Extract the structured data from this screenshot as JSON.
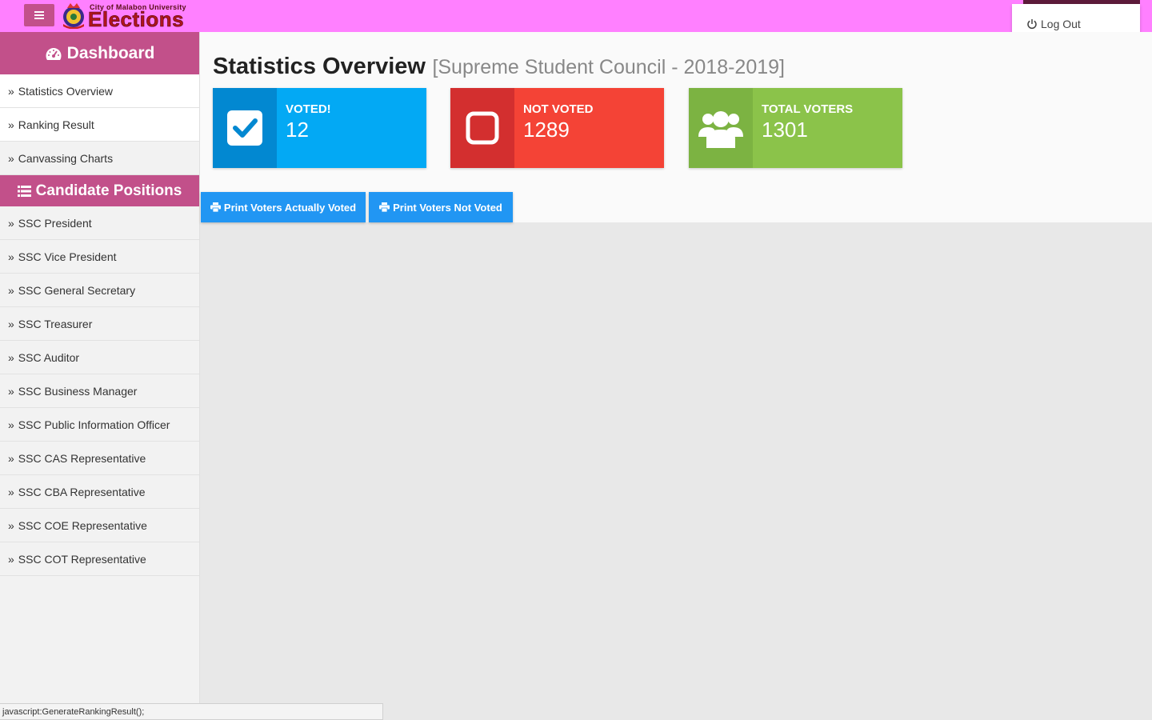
{
  "header": {
    "logo_small": "City of Malabon University",
    "logo_big": "Elections",
    "logout_label": "Log Out"
  },
  "sidebar": {
    "dashboard_title": "Dashboard",
    "dashboard_items": [
      {
        "label": "Statistics Overview"
      },
      {
        "label": "Ranking Result"
      },
      {
        "label": "Canvassing Charts"
      }
    ],
    "positions_title": "Candidate Positions",
    "position_items": [
      {
        "label": "SSC President"
      },
      {
        "label": "SSC Vice President"
      },
      {
        "label": "SSC General Secretary"
      },
      {
        "label": "SSC Treasurer"
      },
      {
        "label": "SSC Auditor"
      },
      {
        "label": "SSC Business Manager"
      },
      {
        "label": "SSC Public Information Officer"
      },
      {
        "label": "SSC CAS Representative"
      },
      {
        "label": "SSC CBA Representative"
      },
      {
        "label": "SSC COE Representative"
      },
      {
        "label": "SSC COT Representative"
      }
    ]
  },
  "main": {
    "title": "Statistics Overview",
    "subtitle": "[Supreme Student Council - 2018-2019]",
    "stats": [
      {
        "label": "VOTED!",
        "value": "12",
        "icon": "check-square-icon",
        "color": "#03a9f4",
        "dark": "#0288d1"
      },
      {
        "label": "NOT VOTED",
        "value": "1289",
        "icon": "empty-square-icon",
        "color": "#f44336",
        "dark": "#d32f2f"
      },
      {
        "label": "TOTAL VOTERS",
        "value": "1301",
        "icon": "users-icon",
        "color": "#8bc34a",
        "dark": "#7cb342"
      }
    ],
    "buttons": {
      "print_voted": "Print Voters Actually Voted",
      "print_not_voted": "Print Voters Not Voted"
    }
  },
  "statusbar": {
    "text": "javascript:GenerateRankingResult();"
  }
}
